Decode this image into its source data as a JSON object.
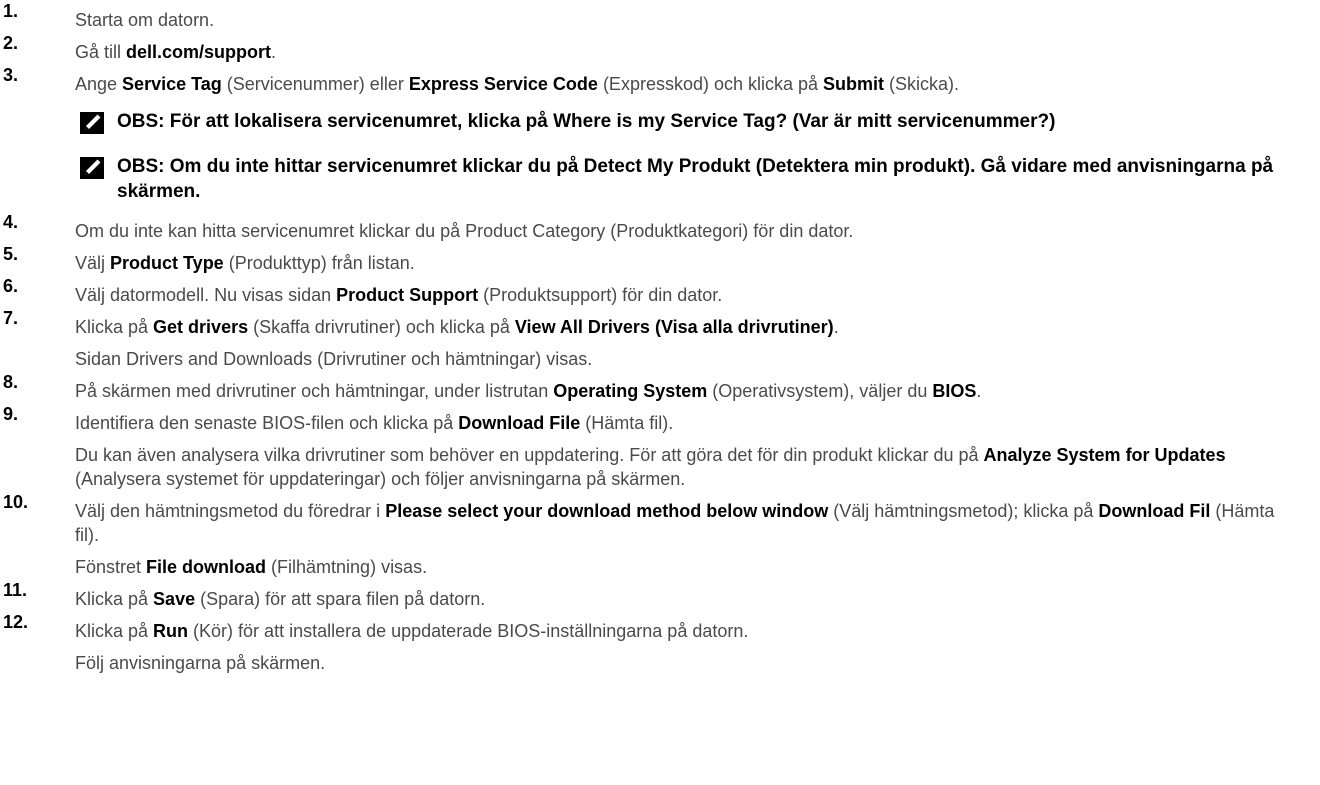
{
  "steps": [
    {
      "num": "1.",
      "parts": [
        {
          "t": "Starta om datorn."
        }
      ]
    },
    {
      "num": "2.",
      "parts": [
        {
          "t": "Gå till "
        },
        {
          "t": "dell.com/support",
          "b": true
        },
        {
          "t": "."
        }
      ]
    },
    {
      "num": "3.",
      "parts": [
        {
          "t": "Ange "
        },
        {
          "t": "Service Tag",
          "b": true
        },
        {
          "t": " (Servicenummer) eller "
        },
        {
          "t": "Express Service Code",
          "b": true
        },
        {
          "t": " (Expresskod) och klicka på "
        },
        {
          "t": "Submit",
          "b": true
        },
        {
          "t": " (Skicka)."
        }
      ]
    }
  ],
  "notes": [
    "OBS: För att lokalisera servicenumret, klicka på Where is my Service Tag? (Var är mitt servicenummer?)",
    "OBS: Om du inte hittar servicenumret klickar du på Detect My Produkt (Detektera min produkt). Gå vidare med anvisningarna på skärmen."
  ],
  "steps2": [
    {
      "num": "4.",
      "parts": [
        {
          "t": "Om du inte kan hitta servicenumret klickar du på Product Category (Produktkategori) för din dator."
        }
      ]
    },
    {
      "num": "5.",
      "parts": [
        {
          "t": "Välj "
        },
        {
          "t": "Product Type",
          "b": true
        },
        {
          "t": " (Produkttyp) från listan."
        }
      ]
    },
    {
      "num": "6.",
      "parts": [
        {
          "t": "Välj datormodell. Nu visas sidan "
        },
        {
          "t": "Product Support",
          "b": true
        },
        {
          "t": " (Produktsupport) för din dator."
        }
      ]
    },
    {
      "num": "7.",
      "parts": [
        {
          "t": "Klicka på "
        },
        {
          "t": "Get drivers",
          "b": true
        },
        {
          "t": " (Skaffa drivrutiner) och klicka på "
        },
        {
          "t": "View All Drivers (Visa alla drivrutiner)",
          "b": true
        },
        {
          "t": "."
        }
      ],
      "sub": [
        [
          {
            "t": "Sidan Drivers and Downloads (Drivrutiner och hämtningar) visas."
          }
        ]
      ]
    },
    {
      "num": "8.",
      "parts": [
        {
          "t": "På skärmen med drivrutiner och hämtningar, under listrutan "
        },
        {
          "t": "Operating System",
          "b": true
        },
        {
          "t": " (Operativsystem), väljer du "
        },
        {
          "t": "BIOS",
          "b": true
        },
        {
          "t": "."
        }
      ]
    },
    {
      "num": "9.",
      "parts": [
        {
          "t": "Identifiera den senaste BIOS-filen och klicka på "
        },
        {
          "t": "Download File",
          "b": true
        },
        {
          "t": " (Hämta fil)."
        }
      ],
      "sub": [
        [
          {
            "t": "Du kan även analysera vilka drivrutiner som behöver en uppdatering. För att göra det för din produkt klickar du på "
          },
          {
            "t": "Analyze System for Updates",
            "b": true
          },
          {
            "t": " (Analysera systemet för uppdateringar) och följer anvisningarna på skärmen."
          }
        ]
      ]
    },
    {
      "num": "10.",
      "parts": [
        {
          "t": "Välj den hämtningsmetod du föredrar i "
        },
        {
          "t": "Please select your download method below window",
          "b": true
        },
        {
          "t": " (Välj hämtningsmetod); klicka på "
        },
        {
          "t": "Download Fil",
          "b": true
        },
        {
          "t": " (Hämta fil)."
        }
      ],
      "sub": [
        [
          {
            "t": "Fönstret "
          },
          {
            "t": "File download",
            "b": true
          },
          {
            "t": " (Filhämtning) visas."
          }
        ]
      ]
    },
    {
      "num": "11.",
      "parts": [
        {
          "t": "Klicka på "
        },
        {
          "t": "Save",
          "b": true
        },
        {
          "t": " (Spara) för att spara filen på datorn."
        }
      ]
    },
    {
      "num": "12.",
      "parts": [
        {
          "t": "Klicka på "
        },
        {
          "t": "Run",
          "b": true
        },
        {
          "t": " (Kör) för att installera de uppdaterade BIOS-inställningarna på datorn."
        }
      ],
      "sub": [
        [
          {
            "t": "Följ anvisningarna på skärmen."
          }
        ]
      ]
    }
  ]
}
